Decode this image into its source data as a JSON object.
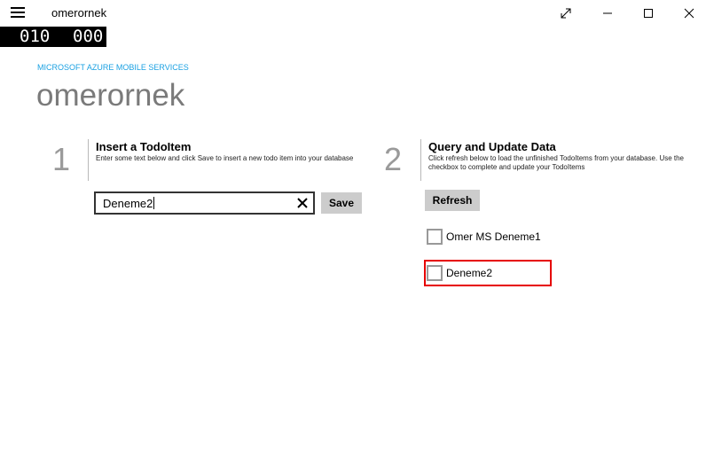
{
  "window": {
    "title": "omerornek"
  },
  "frame_counter": {
    "left": "010",
    "right": "000"
  },
  "header": {
    "service_label": "MICROSOFT AZURE MOBILE SERVICES",
    "title": "omerornek"
  },
  "step1": {
    "number": "1",
    "heading": "Insert a TodoItem",
    "description": "Enter some text below and click Save to insert a new todo item into your database",
    "input_value": "Deneme2",
    "save_label": "Save"
  },
  "step2": {
    "number": "2",
    "heading": "Query and Update Data",
    "description": "Click refresh below to load the unfinished TodoItems from your database. Use the checkbox to complete and update your TodoItems",
    "refresh_label": "Refresh",
    "items": [
      {
        "text": "Omer MS Deneme1",
        "checked": false
      },
      {
        "text": "Deneme2",
        "checked": false
      }
    ]
  },
  "colors": {
    "accent": "#1ba1e2",
    "highlight": "#e60000",
    "button_bg": "#cccccc"
  }
}
